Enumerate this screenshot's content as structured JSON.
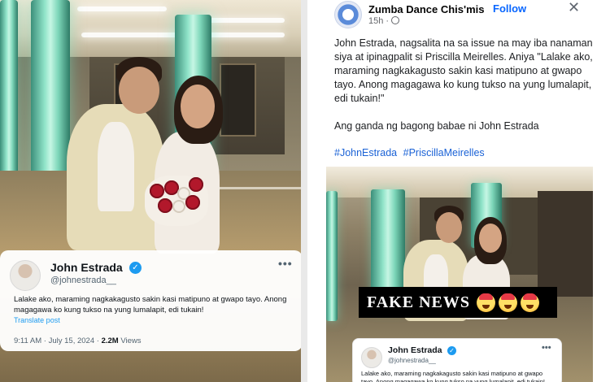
{
  "tweet": {
    "name": "John Estrada",
    "handle": "@johnestrada__",
    "more": "•••",
    "text": "Lalake ako, maraming nagkakagusto sakin kasi matipuno at gwapo tayo. Anong magagawa ko kung tukso na yung lumalapit, edi tukain!",
    "translate": "Translate post",
    "time": "9:11 AM",
    "date": "July 15, 2024",
    "views_count": "2.2M",
    "views_label": "Views",
    "verified_glyph": "✓"
  },
  "fb_post": {
    "page_name": "Zumba Dance Chis'mis",
    "separator": "·",
    "follow_label": "Follow",
    "close_glyph": "✕",
    "time": "15h ·",
    "paragraph_1": "John Estrada, nagsalita na sa issue na may iba nanaman siya at ipinagpalit si Priscilla Meirelles. Aniya \"Lalake ako, maraming nagkakagusto sakin kasi matipuno at gwapo tayo. Anong magagawa ko kung tukso na yung lumalapit, edi tukain!\"",
    "paragraph_2": "Ang ganda ng bagong babae ni John Estrada",
    "hashtags": [
      "#JohnEstrada",
      "#PriscillaMeirelles"
    ],
    "banner_text": "FAKE NEWS",
    "embedded_tweet": {
      "name": "John Estrada",
      "handle": "@johnestrada__",
      "more": "•••",
      "text": "Lalake ako, maraming nagkakagusto sakin kasi matipuno at gwapo tayo. Anong magagawa ko kung tukso na yung lumalapit, edi tukain!"
    }
  },
  "colors": {
    "x_blue": "#1d9bf0",
    "fb_blue": "#0866ff",
    "hashtag_blue": "#1a62d6",
    "pillar_green": "#8fe3c8"
  },
  "icons": [
    "verified-badge-icon",
    "more-options-icon",
    "close-icon",
    "globe-icon",
    "angry-face-emoji"
  ]
}
